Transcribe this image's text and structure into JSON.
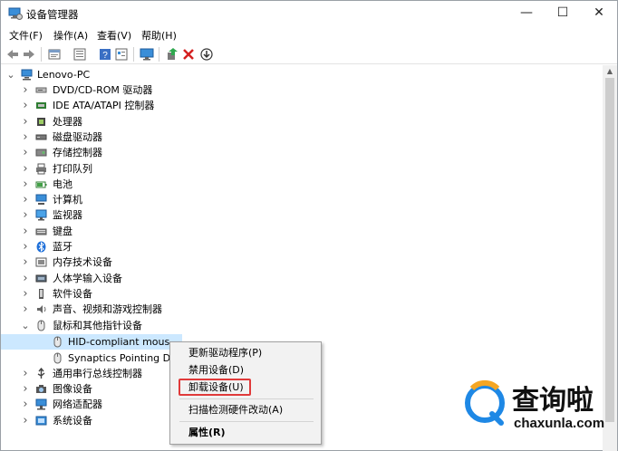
{
  "window": {
    "title": "设备管理器",
    "minimize": "—",
    "maximize": "☐",
    "close": "✕"
  },
  "menu": [
    "文件(F)",
    "操作(A)",
    "查看(V)",
    "帮助(H)"
  ],
  "tree": {
    "root": "Lenovo-PC",
    "categories": [
      {
        "label": "DVD/CD-ROM 驱动器",
        "icon": "dvd-drive-icon"
      },
      {
        "label": "IDE ATA/ATAPI 控制器",
        "icon": "ide-controller-icon"
      },
      {
        "label": "处理器",
        "icon": "processor-icon"
      },
      {
        "label": "磁盘驱动器",
        "icon": "disk-drive-icon"
      },
      {
        "label": "存储控制器",
        "icon": "storage-controller-icon"
      },
      {
        "label": "打印队列",
        "icon": "printer-icon"
      },
      {
        "label": "电池",
        "icon": "battery-icon"
      },
      {
        "label": "计算机",
        "icon": "computer-icon"
      },
      {
        "label": "监视器",
        "icon": "monitor-icon"
      },
      {
        "label": "键盘",
        "icon": "keyboard-icon"
      },
      {
        "label": "蓝牙",
        "icon": "bluetooth-icon"
      },
      {
        "label": "内存技术设备",
        "icon": "memory-device-icon"
      },
      {
        "label": "人体学输入设备",
        "icon": "hid-icon"
      },
      {
        "label": "软件设备",
        "icon": "software-device-icon"
      },
      {
        "label": "声音、视频和游戏控制器",
        "icon": "sound-icon"
      },
      {
        "label": "鼠标和其他指针设备",
        "icon": "mouse-icon",
        "expanded": true
      },
      {
        "label": "通用串行总线控制器",
        "icon": "usb-icon"
      },
      {
        "label": "图像设备",
        "icon": "camera-icon"
      },
      {
        "label": "网络适配器",
        "icon": "network-adapter-icon"
      },
      {
        "label": "系统设备",
        "icon": "system-device-icon"
      }
    ],
    "mouse_children": [
      {
        "label": "HID-compliant mous",
        "selected": true
      },
      {
        "label": "Synaptics Pointing D",
        "selected": false
      }
    ]
  },
  "context_menu": {
    "items": [
      {
        "label": "更新驱动程序(P)"
      },
      {
        "label": "禁用设备(D)"
      },
      {
        "label": "卸载设备(U)",
        "highlighted": true
      },
      {
        "label": "扫描检测硬件改动(A)"
      },
      {
        "label": "属性(R)",
        "bold": true
      }
    ]
  },
  "watermark": {
    "brand": "查询啦",
    "domain": "chaxunla.com"
  },
  "colors": {
    "highlight_box": "#e03a3a",
    "selection": "#cce8ff",
    "accent": "#1e88e5"
  }
}
